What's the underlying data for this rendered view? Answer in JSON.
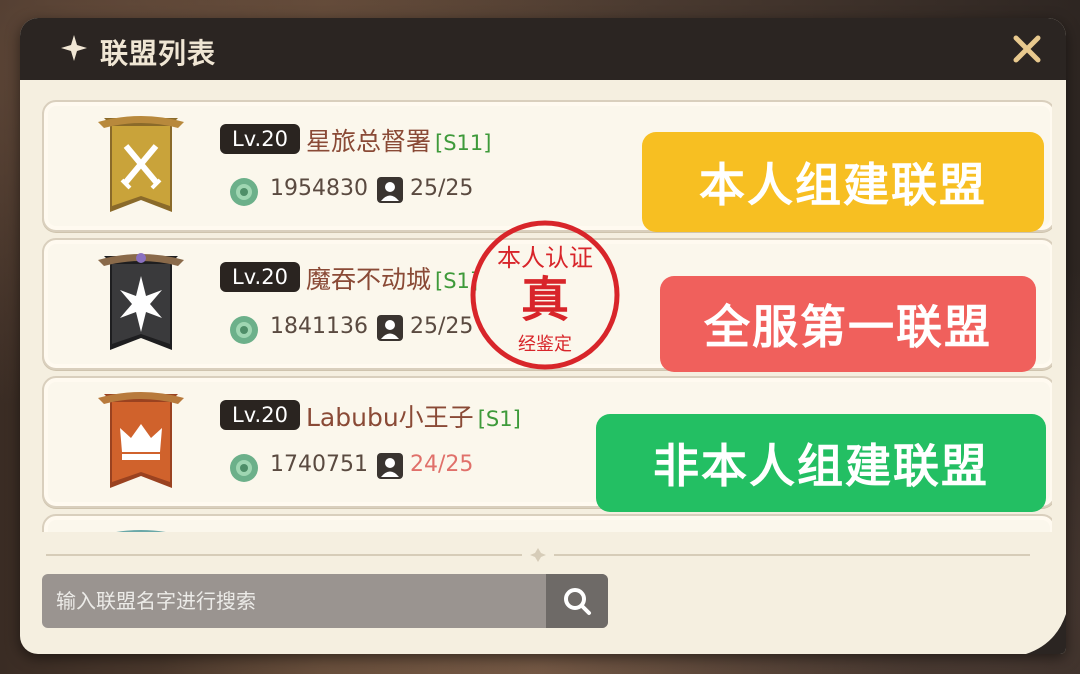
{
  "header": {
    "title": "联盟列表",
    "close_icon": "close-icon",
    "star_icon": "sparkle-icon"
  },
  "alliances": [
    {
      "level": "Lv.20",
      "name": "星旅总督署",
      "server": "[S11]",
      "power": "1954830",
      "members": "25/25",
      "banner_icon": "crossed-swords-icon",
      "banner_color": "#c9a33a",
      "members_color": "#5a4a40"
    },
    {
      "level": "Lv.20",
      "name": "魔吞不动城",
      "server": "[S1]",
      "power": "1841136",
      "members": "25/25",
      "banner_icon": "star-burst-icon",
      "banner_color": "#3a3a3c",
      "members_color": "#5a4a40"
    },
    {
      "level": "Lv.20",
      "name": "Labubu小王子",
      "server": "[S1]",
      "power": "1740751",
      "members": "24/25",
      "banner_icon": "crown-icon",
      "banner_color": "#d0622c",
      "members_color": "#e0706a"
    }
  ],
  "overlays": {
    "own_alliance": {
      "label": "本人组建联盟",
      "color": "#f7bf22"
    },
    "top_alliance": {
      "label": "全服第一联盟",
      "color": "#f0605c"
    },
    "not_own_alliance": {
      "label": "非本人组建联盟",
      "color": "#23bf63"
    }
  },
  "stamp": {
    "top_text": "本人认证",
    "center_text": "真",
    "bottom_text": "经鉴定",
    "color": "#d8252a"
  },
  "search": {
    "placeholder": "输入联盟名字进行搜索",
    "value": "",
    "icon": "search-icon"
  }
}
